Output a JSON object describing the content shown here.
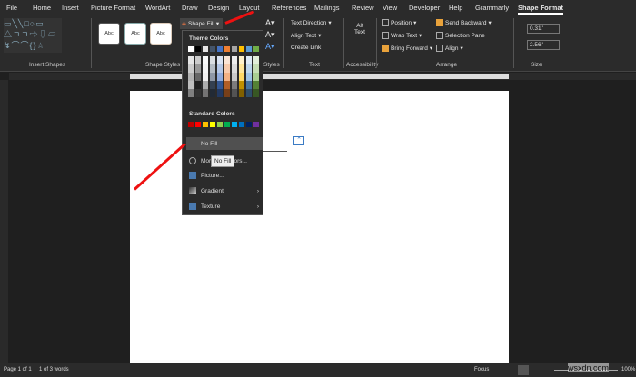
{
  "tabs": [
    "File",
    "Home",
    "Insert",
    "Picture Format",
    "WordArt",
    "Draw",
    "Design",
    "Layout",
    "References",
    "Mailings",
    "Review",
    "View",
    "Developer",
    "Help",
    "Grammarly",
    "Shape Format"
  ],
  "ribbon": {
    "groups": {
      "insert_shapes": "Insert Shapes",
      "shape_styles": "Shape Styles",
      "wordart_styles": "Styles",
      "text": "Text",
      "accessibility": "Accessibility",
      "arrange": "Arrange",
      "size": "Size"
    },
    "style_samples": [
      "Abc",
      "Abc",
      "Abc"
    ],
    "shape_fill": "Shape Fill",
    "text_direction": "Text Direction",
    "align_text": "Align Text",
    "create_link": "Create Link",
    "alt_text": "Alt Text",
    "position": "Position",
    "wrap_text": "Wrap Text",
    "bring_forward": "Bring Forward",
    "send_backward": "Send Backward",
    "selection_pane": "Selection Pane",
    "align": "Align",
    "height": "0.31\"",
    "width": "2.56\""
  },
  "menu": {
    "theme_colors_label": "Theme Colors",
    "theme_colors": [
      "#ffffff",
      "#000000",
      "#e7e6e6",
      "#44546a",
      "#4472c4",
      "#ed7d31",
      "#a5a5a5",
      "#ffc000",
      "#5b9bd5",
      "#70ad47"
    ],
    "standard_colors_label": "Standard Colors",
    "standard_colors": [
      "#c00000",
      "#ff0000",
      "#ffc000",
      "#ffff00",
      "#92d050",
      "#00b050",
      "#00b0f0",
      "#0070c0",
      "#002060",
      "#7030a0"
    ],
    "items": [
      "No Fill",
      "More Fill Colors...",
      "Picture...",
      "Gradient",
      "Texture"
    ],
    "tooltip": "No Fill"
  },
  "status": {
    "page": "Page 1 of 1",
    "words": "1 of 3 words",
    "focus": "Focus",
    "zoom": "100%"
  },
  "watermark": "wsxdn.com"
}
